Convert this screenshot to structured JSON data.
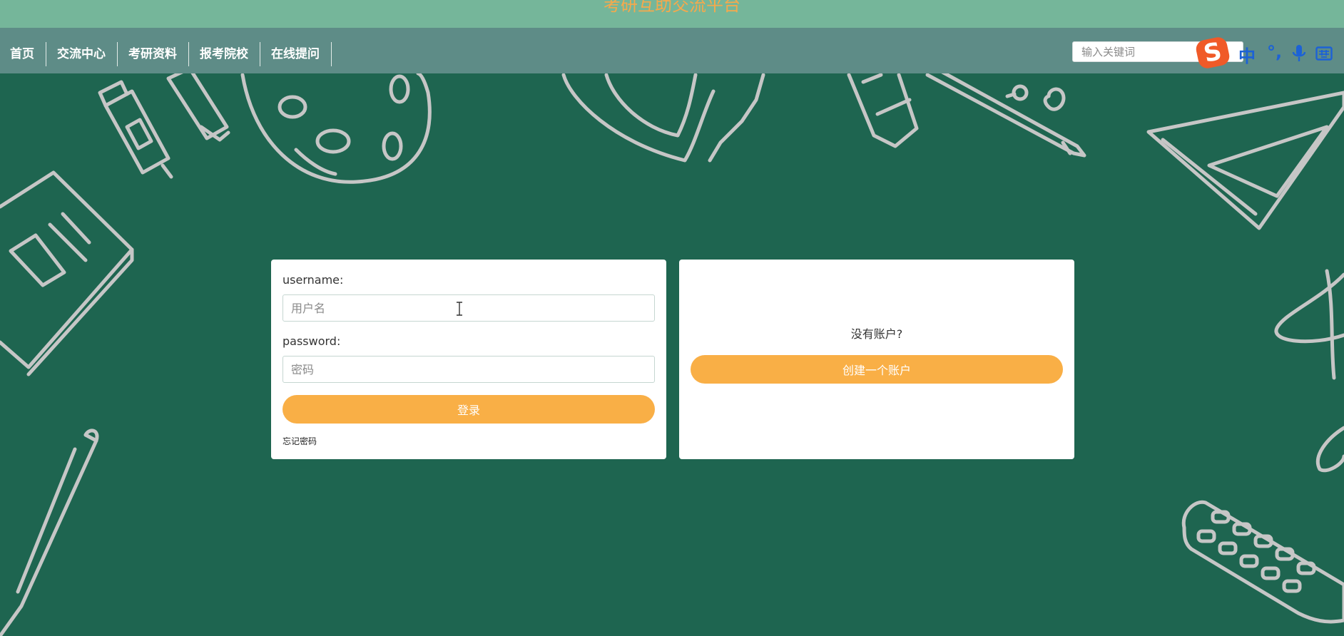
{
  "header": {
    "site_title": "考研互助交流平台"
  },
  "nav": {
    "items": [
      {
        "label": "首页"
      },
      {
        "label": "交流中心"
      },
      {
        "label": "考研资料"
      },
      {
        "label": "报考院校"
      },
      {
        "label": "在线提问"
      }
    ],
    "search_placeholder": "输入关键词"
  },
  "ime_toolbar": {
    "logo": "S",
    "mode_label": "中",
    "icons": [
      "punctuation-icon",
      "microphone-icon",
      "keyboard-icon"
    ]
  },
  "login_card": {
    "username_label": "username:",
    "username_placeholder": "用户名",
    "username_value": "",
    "password_label": "password:",
    "password_placeholder": "密码",
    "password_value": "",
    "login_button": "登录",
    "forgot_password": "忘记密码"
  },
  "register_card": {
    "prompt": "没有账户?",
    "create_button": "创建一个账户"
  },
  "colors": {
    "background": "#1e6550",
    "top_bar": "#75b69a",
    "nav_bar": "#5e8c87",
    "title_text": "#f5a94c",
    "button": "#f9af46",
    "card": "#ffffff",
    "doodle_stroke": "#c6c6c6"
  }
}
